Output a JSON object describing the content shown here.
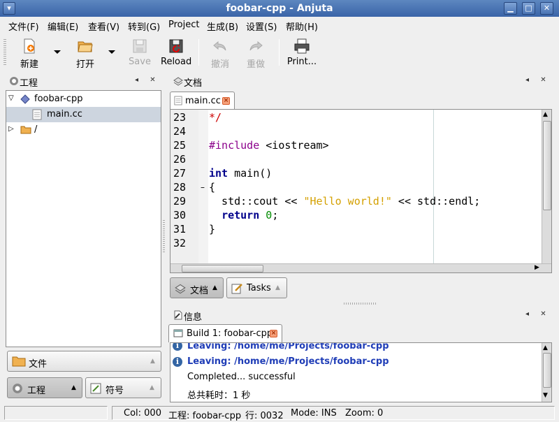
{
  "window": {
    "title": "foobar-cpp - Anjuta"
  },
  "menu": [
    "文件(F)",
    "编辑(E)",
    "查看(V)",
    "转到(G)",
    "Project",
    "生成(B)",
    "设置(S)",
    "帮助(H)"
  ],
  "toolbar": {
    "new_label": "新建",
    "open_label": "打开",
    "save_label": "Save",
    "reload_label": "Reload",
    "undo_label": "撤消",
    "redo_label": "重做",
    "print_label": "Print..."
  },
  "project_panel": {
    "title": "工程",
    "root": "foobar-cpp",
    "file": "main.cc",
    "dir": "/"
  },
  "doc_panel": {
    "title": "文档",
    "tab": "main.cc"
  },
  "editor": {
    "lines": [
      {
        "n": "23",
        "text": "*/"
      },
      {
        "n": "24",
        "text": ""
      },
      {
        "n": "25",
        "text": "#include <iostream>"
      },
      {
        "n": "26",
        "text": ""
      },
      {
        "n": "27",
        "text": "int main()"
      },
      {
        "n": "28",
        "text": "{"
      },
      {
        "n": "29",
        "text": "  std::cout << \"Hello world!\" << std::endl;"
      },
      {
        "n": "30",
        "text": "  return 0;"
      },
      {
        "n": "31",
        "text": "}"
      },
      {
        "n": "32",
        "text": ""
      }
    ]
  },
  "doc_switch": {
    "docs": "文档",
    "tasks": "Tasks"
  },
  "left_switch": {
    "files": "文件",
    "project": "工程",
    "symbols": "符号"
  },
  "messages_panel": {
    "title": "信息",
    "tab": "Build 1: foobar-cpp",
    "lines": [
      "Leaving: /home/me/Projects/foobar-cpp",
      "Leaving: /home/me/Projects/foobar-cpp",
      "Completed... successful",
      "总共耗时：1 秒"
    ]
  },
  "status": {
    "col": "Col: 000",
    "project": "工程: foobar-cpp",
    "row": "行: 0032",
    "mode": "Mode: INS",
    "zoom": "Zoom: 0"
  },
  "colors": {
    "keyword": "#00008b",
    "string": "#d4a000",
    "comment": "#cc0000",
    "preprocessor": "#8b008b",
    "number": "#008b00",
    "title_bar": "#3a64a8",
    "output_blue": "#1f3db7"
  }
}
